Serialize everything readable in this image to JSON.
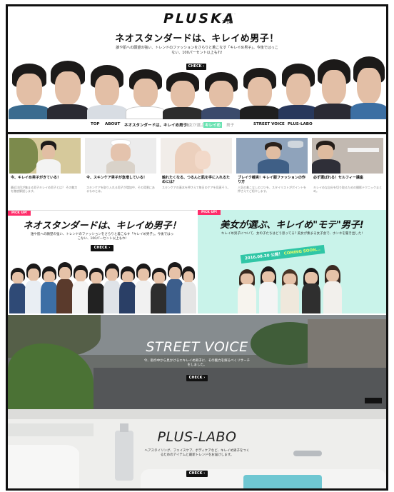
{
  "header": {
    "logo": "PLUSKA",
    "logo_sub": "ﾌﾟﾗｽｶ",
    "hero_title": "ネオスタンダードは、キレイめ男子！",
    "hero_sub": "誰や肌への願望の強い、トレンドのファッションをさらりと着こなす「キレイめ男子」。今後ではっこない、100パーセント以上もれ!",
    "check_label": "CHECK"
  },
  "nav": [
    {
      "label": "TOP"
    },
    {
      "label": "ABOUT"
    },
    {
      "label": "ネオスタンダードは、キレイめ男子!"
    },
    {
      "label": "美女が選ぶ"
    },
    {
      "label": "キレイめ"
    },
    {
      "label": "男子"
    },
    {
      "label": "STREET VOICE"
    },
    {
      "label": "PLUS-LABO"
    }
  ],
  "cards": [
    {
      "title": "今、キレイめ男子がきている！",
      "desc": "最近注目が集まる男子キレイめ男子とは？ その魅力を徹底解説します。"
    },
    {
      "title": "今、スキンケア男子が急増している！",
      "desc": "スキンケアを取り入れる男子が増加中、その背景にあるものとは。"
    },
    {
      "title": "触れたくなる、つるんと肌を手に入れるためには？",
      "desc": "スキンケアの基本を押さえて毎日のケアを見直そう。"
    },
    {
      "title": "ブレイク確実！キレイ服ファッションの作り方",
      "desc": "人気の着こなしのコツを、スタイリストがポイントを押さえてご紹介します。"
    },
    {
      "title": "必ず選ばれる！セルフィー講座",
      "desc": "キレイめな自分を切り取るための撮影テクニックまとめ。"
    }
  ],
  "panel_left": {
    "badge": "PICK UP!",
    "title": "ネオスタンダードは、キレイめ男子！",
    "sub": "誰や肌への願望の強い、トレンドのファッションをさらりと着こなす「キレイめ男子」。今後ではっこない、100パーセント以上もれ!",
    "check_label": "CHECK"
  },
  "panel_right": {
    "badge": "PICK UP!",
    "title": "美女が選ぶ、キレイめ\"モテ\"男子!",
    "sub": "キレイめ男子について、女の子たちはどう思ってる? 美女が集まる女子会で、ホンネを聞き出した!",
    "ribbon_date": "2016.08.30 公開！",
    "ribbon_coming": "COMING SOON..."
  },
  "street": {
    "title": "STREET VOICE",
    "sub": "今、街の中から見かけるエキレイめ男子に、その魅力を探るべくリサーチをしました。",
    "check_label": "CHECK"
  },
  "labo": {
    "title": "PLUS-LABO",
    "sub": "ヘアスタイリング、フェイスケア、ボディケアなど、キレイめ男子をつくるためのアイテムと最新トレンドをお届けします。",
    "check_label": "CHECK"
  },
  "colors": {
    "accent_green": "#6be3b3",
    "pickup_pink": "#ff2d6a",
    "ribbon_teal": "#30c6a6",
    "panel_mint": "#c9f3ea"
  }
}
